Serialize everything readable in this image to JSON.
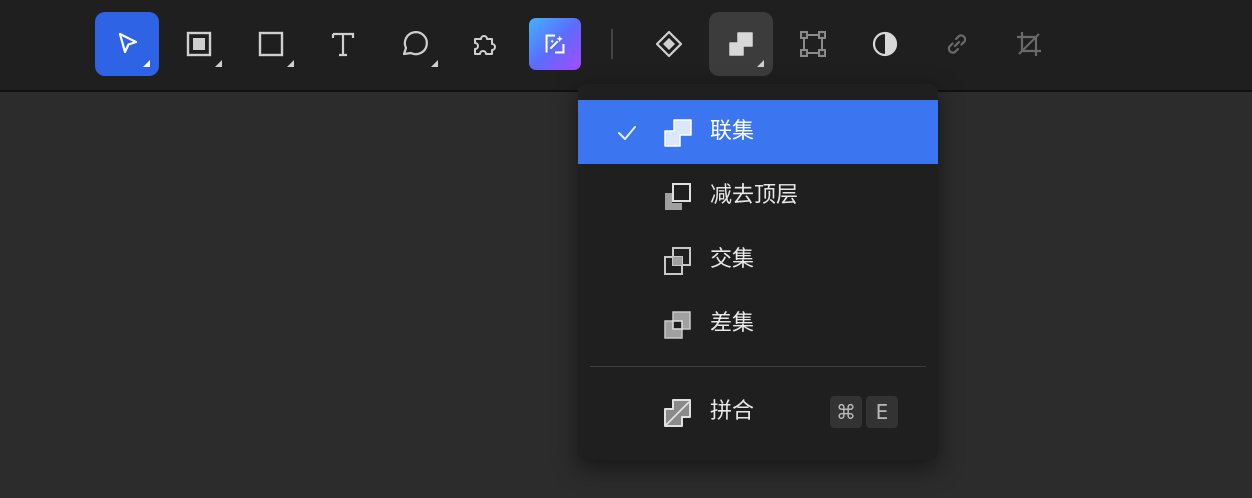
{
  "toolbar": {
    "tools": [
      {
        "name": "select-tool",
        "icon": "pointer-icon",
        "active": true
      },
      {
        "name": "frame-tool",
        "icon": "frame-icon"
      },
      {
        "name": "rectangle-tool",
        "icon": "rectangle-icon"
      },
      {
        "name": "text-tool",
        "icon": "text-icon",
        "glyph": "T"
      },
      {
        "name": "speech-bubble-tool",
        "icon": "speech-bubble-icon"
      },
      {
        "name": "plugin-tool",
        "icon": "puzzle-icon"
      },
      {
        "name": "ai-magic-tool",
        "icon": "ai-sparkle-icon"
      },
      {
        "name": "component-tool",
        "icon": "diamond-icon"
      },
      {
        "name": "boolean-tool",
        "icon": "boolean-union-icon",
        "pressed": true
      },
      {
        "name": "transform-tool",
        "icon": "bounding-box-icon"
      },
      {
        "name": "mask-tool",
        "icon": "contrast-icon"
      },
      {
        "name": "link-tool",
        "icon": "link-icon"
      },
      {
        "name": "crop-tool",
        "icon": "crop-icon"
      }
    ],
    "accent_color": "#2f63e6"
  },
  "boolean_menu": {
    "items": [
      {
        "label": "联集",
        "icon": "union-icon",
        "checked": true
      },
      {
        "label": "减去顶层",
        "icon": "subtract-icon"
      },
      {
        "label": "交集",
        "icon": "intersect-icon"
      },
      {
        "label": "差集",
        "icon": "exclude-icon"
      },
      {
        "label": "拼合",
        "icon": "flatten-icon",
        "shortcut": [
          "⌘",
          "E"
        ]
      }
    ],
    "selected_color": "#3b76f0"
  }
}
